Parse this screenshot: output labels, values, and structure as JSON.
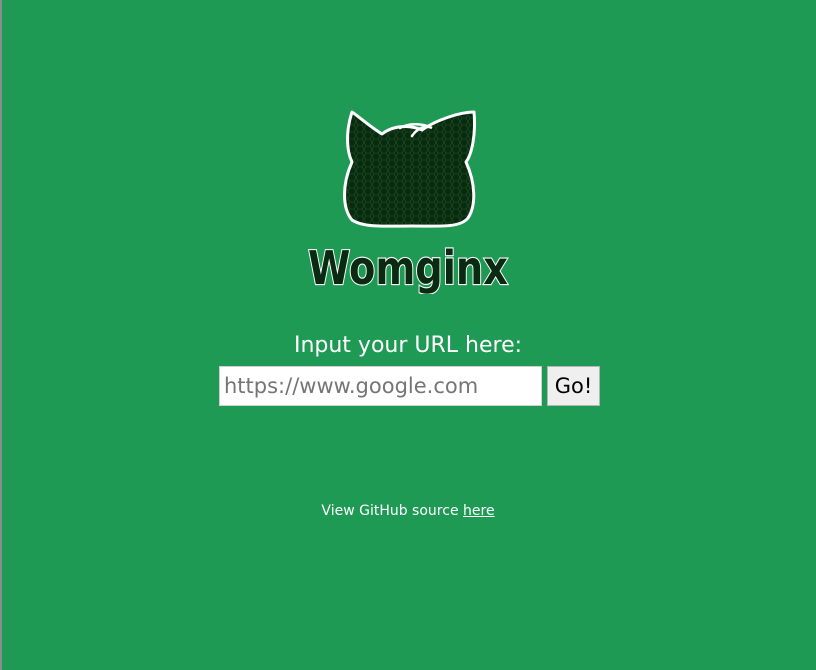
{
  "logo": {
    "wordmark": "Womginx",
    "icon": "cat-head-icon"
  },
  "form": {
    "prompt": "Input your URL here:",
    "url_placeholder": "https://www.google.com",
    "url_value": "",
    "go_label": "Go!"
  },
  "footer": {
    "text": "View GitHub source",
    "link_label": "here"
  },
  "colors": {
    "background": "#1f9a55",
    "logo_fill": "#0b2a12",
    "logo_outline": "#ffffff"
  }
}
